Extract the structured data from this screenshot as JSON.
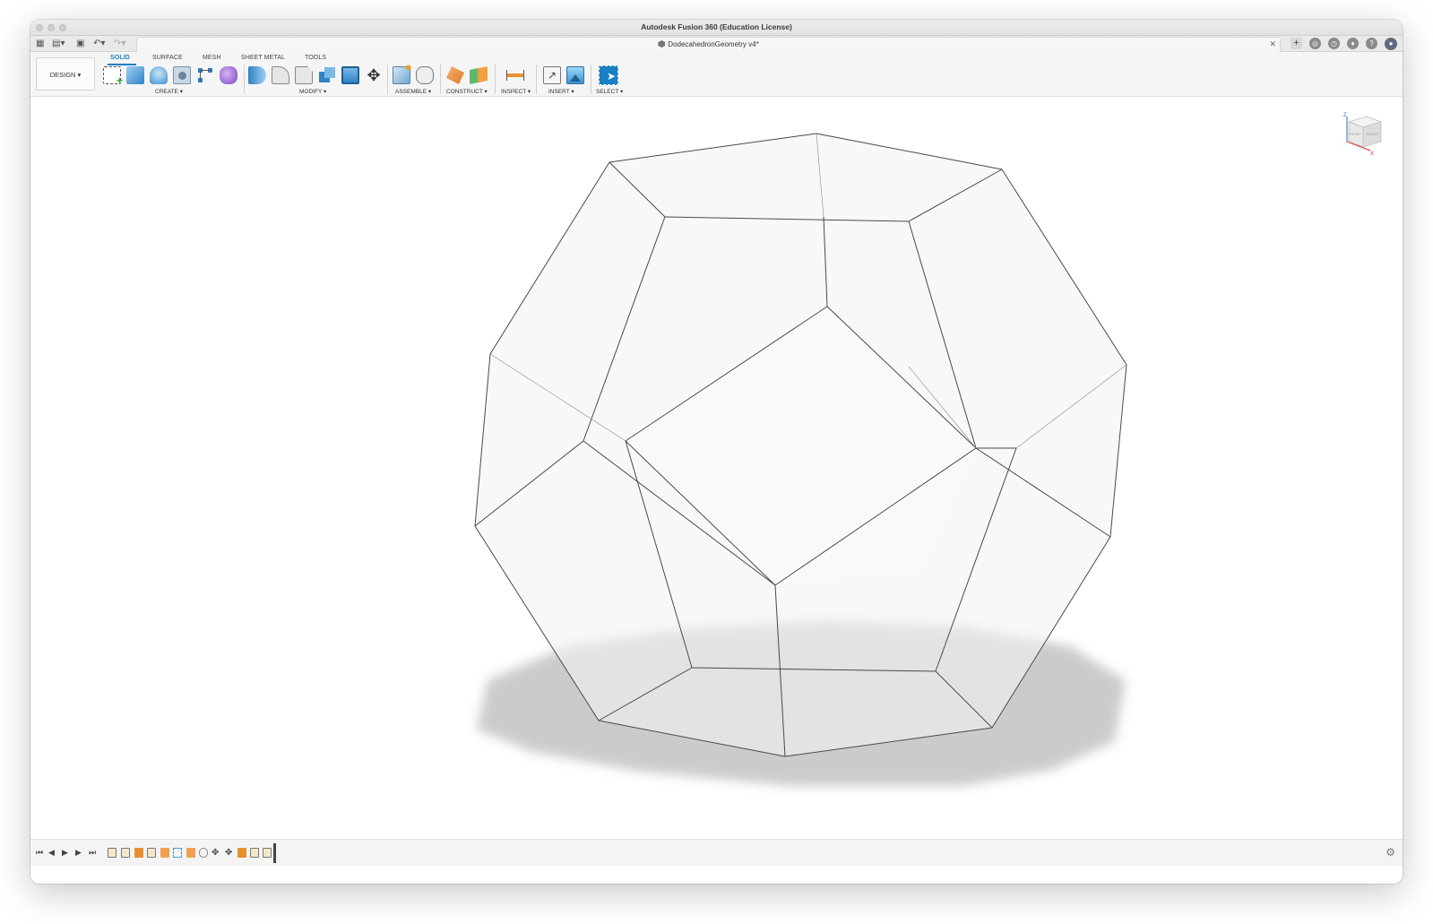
{
  "window": {
    "title": "Autodesk Fusion 360 (Education License)"
  },
  "tab_bar": {
    "document_title": "DodecahedronGeometry v4*",
    "quick_access": [
      "grid-icon",
      "file-icon",
      "save-icon",
      "undo-icon",
      "redo-icon"
    ],
    "right_icons": [
      "new-tab-icon",
      "extensions-icon",
      "job-status-icon",
      "notifications-icon",
      "help-icon",
      "user-avatar-icon"
    ]
  },
  "toolbar": {
    "workspace_label": "DESIGN",
    "workspace_caret": "▾",
    "tabs": [
      {
        "label": "SOLID",
        "active": true
      },
      {
        "label": "SURFACE",
        "active": false
      },
      {
        "label": "MESH",
        "active": false
      },
      {
        "label": "SHEET METAL",
        "active": false
      },
      {
        "label": "TOOLS",
        "active": false
      }
    ],
    "groups": [
      {
        "label": "CREATE ▾",
        "tools": [
          "create-sketch-icon",
          "extrude-icon",
          "revolve-icon",
          "hole-icon",
          "pattern-icon",
          "form-icon"
        ]
      },
      {
        "label": "MODIFY ▾",
        "tools": [
          "press-pull-icon",
          "fillet-icon",
          "chamfer-icon",
          "combine-icon",
          "shell-icon",
          "move-icon"
        ]
      },
      {
        "label": "ASSEMBLE ▾",
        "tools": [
          "new-component-icon",
          "joint-icon"
        ]
      },
      {
        "label": "CONSTRUCT ▾",
        "tools": [
          "offset-plane-icon",
          "midplane-icon"
        ]
      },
      {
        "label": "INSPECT ▾",
        "tools": [
          "measure-icon"
        ]
      },
      {
        "label": "INSERT ▾",
        "tools": [
          "insert-derive-icon",
          "insert-image-icon"
        ]
      },
      {
        "label": "SELECT ▾",
        "tools": [
          "select-icon"
        ]
      }
    ]
  },
  "viewcube": {
    "face_front": "FRONT",
    "face_right": "RIGHT",
    "axis_z": "Z",
    "axis_x": "X"
  },
  "timeline": {
    "controls": [
      "skip-start-icon",
      "step-back-icon",
      "play-icon",
      "step-forward-icon",
      "skip-end-icon"
    ],
    "features": [
      "sketch",
      "sketch",
      "extrude",
      "sketch",
      "surface",
      "pattern",
      "surface",
      "pattern",
      "move",
      "move",
      "move",
      "orange",
      "sketch",
      "marker"
    ],
    "settings_icon": "gear-icon"
  },
  "colors": {
    "accent": "#1a7fc4",
    "edge": "#4a4a4a",
    "shadow": "#c9c9c9"
  }
}
